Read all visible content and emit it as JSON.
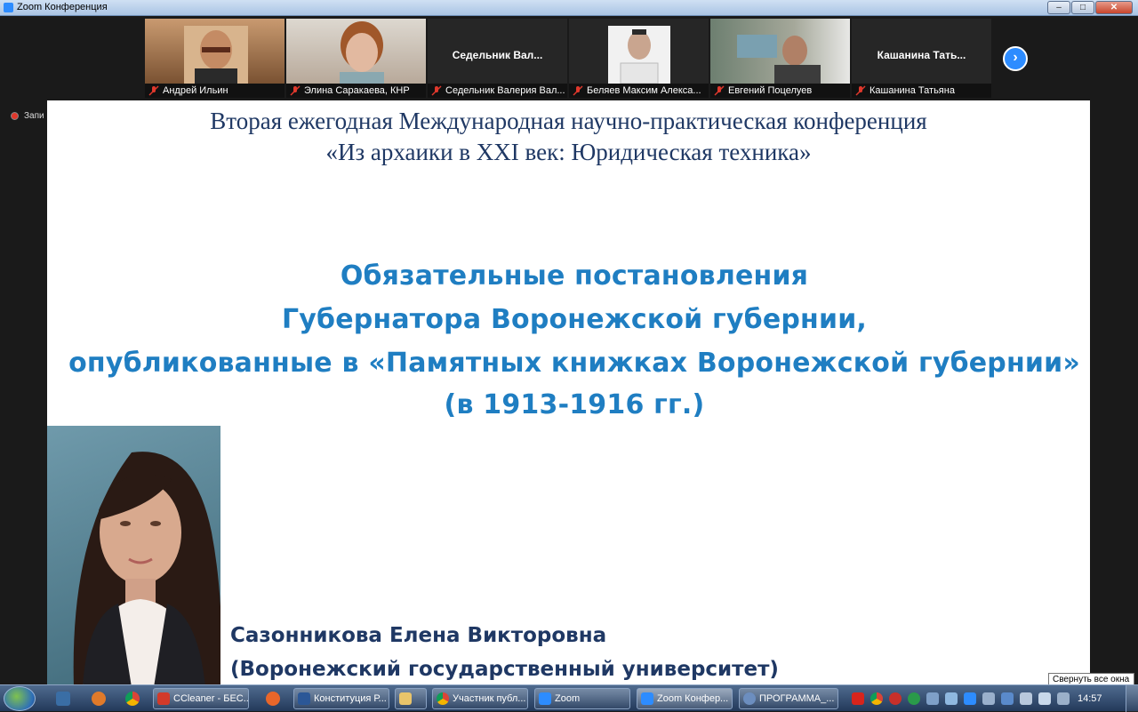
{
  "window": {
    "title": "Zoom Конференция",
    "controls": [
      "minimize-icon",
      "maximize-icon",
      "close-icon"
    ]
  },
  "participants": [
    {
      "name": "Андрей Ильин",
      "display_name": "",
      "muted": true
    },
    {
      "name": "Элина Саракаева, КНР",
      "display_name": "",
      "muted": true
    },
    {
      "name": "Седельник Валерия Вал...",
      "display_name": "Седельник Вал...",
      "muted": true
    },
    {
      "name": "Беляев Максим Алекса...",
      "display_name": "",
      "muted": true
    },
    {
      "name": "Евгений Поцелуев",
      "display_name": "",
      "muted": true
    },
    {
      "name": "Кашанина Татьяна",
      "display_name": "Кашанина Тать...",
      "muted": true
    }
  ],
  "recording": {
    "label": "Запи"
  },
  "slide": {
    "conference_line1": "Вторая ежегодная Международная научно-практическая конференция",
    "conference_line2": "«Из архаики в XXI век: Юридическая техника»",
    "headline_line1": "Обязательные постановления",
    "headline_line2": "Губернатора Воронежской губернии,",
    "headline_line3": "опубликованные в «Памятных книжках Воронежской губернии»",
    "headline_line4": "(в 1913-1916 гг.)",
    "author": "Сазонникова Елена Викторовна",
    "affiliation": "(Воронежский государственный университет)"
  },
  "tooltip": "Свернуть все окна",
  "taskbar": {
    "tasks": [
      {
        "label": "CCleaner - БЕС...",
        "icon": "ccleaner-icon"
      },
      {
        "label": "Конституция Р...",
        "icon": "word-icon"
      },
      {
        "label": "",
        "icon": "folder-icon"
      },
      {
        "label": "Участник публ...",
        "icon": "chrome-icon"
      },
      {
        "label": "Zoom",
        "icon": "zoom-icon"
      },
      {
        "label": "Zoom Конфер...",
        "icon": "zoom-icon"
      },
      {
        "label": "ПРОГРАММА_...",
        "icon": "browser-icon"
      }
    ],
    "clock": "14:57"
  },
  "colors": {
    "zoom_blue": "#2d8cff",
    "slide_title": "#1f3864",
    "slide_headline": "#1f7ec2",
    "mute_red": "#e0382c"
  }
}
